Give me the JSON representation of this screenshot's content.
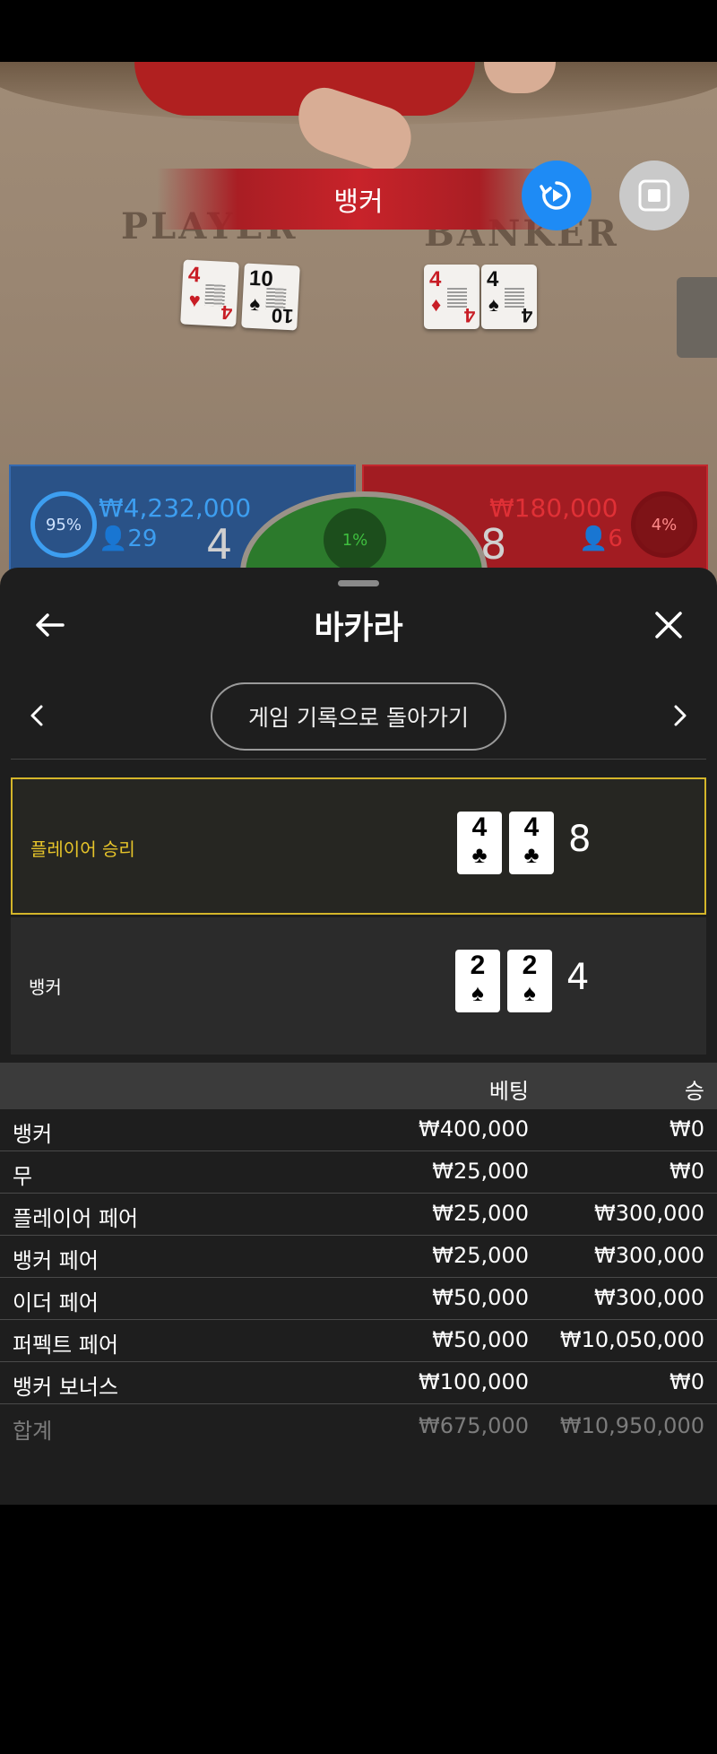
{
  "game": {
    "result_banner": "뱅커",
    "table_labels": {
      "player": "PLAYER",
      "banker": "BANKER"
    },
    "table_cards": {
      "player": [
        {
          "rank": "4",
          "suit": "♥",
          "color": "#c81d25"
        },
        {
          "rank": "10",
          "suit": "♠",
          "color": "#111111"
        }
      ],
      "banker": [
        {
          "rank": "4",
          "suit": "♦",
          "color": "#c81d25"
        },
        {
          "rank": "4",
          "suit": "♠",
          "color": "#111111"
        }
      ]
    }
  },
  "controls": {
    "replay_icon": "replay-icon",
    "stop_icon": "stop-icon"
  },
  "panels": {
    "player": {
      "percent": "95%",
      "amount": "₩4,232,000",
      "count": "29",
      "score": "4",
      "color": "#2a5287"
    },
    "tie": {
      "percent": "1%",
      "color": "#2c7a2c"
    },
    "banker": {
      "percent": "4%",
      "amount": "₩180,000",
      "count": "6",
      "score": "8",
      "color": "#a21c22"
    }
  },
  "sheet": {
    "title": "바카라",
    "history_button": "게임 기록으로 돌아가기",
    "results": [
      {
        "label": "플레이어 승리",
        "cards": [
          {
            "rank": "4",
            "suit": "♣"
          },
          {
            "rank": "4",
            "suit": "♣"
          }
        ],
        "score": "8",
        "highlight": "#d4b52a"
      },
      {
        "label": "뱅커",
        "cards": [
          {
            "rank": "2",
            "suit": "♠"
          },
          {
            "rank": "2",
            "suit": "♠"
          }
        ],
        "score": "4"
      }
    ],
    "bet_table": {
      "headers": {
        "bet": "베팅",
        "win": "승"
      },
      "rows": [
        {
          "name": "뱅커",
          "bet": "₩400,000",
          "win": "₩0"
        },
        {
          "name": "무",
          "bet": "₩25,000",
          "win": "₩0"
        },
        {
          "name": "플레이어 페어",
          "bet": "₩25,000",
          "win": "₩300,000"
        },
        {
          "name": "뱅커 페어",
          "bet": "₩25,000",
          "win": "₩300,000"
        },
        {
          "name": "이더 페어",
          "bet": "₩50,000",
          "win": "₩300,000"
        },
        {
          "name": "퍼펙트 페어",
          "bet": "₩50,000",
          "win": "₩10,050,000"
        },
        {
          "name": "뱅커 보너스",
          "bet": "₩100,000",
          "win": "₩0"
        }
      ],
      "total": {
        "name": "합계",
        "bet": "₩675,000",
        "win": "₩10,950,000"
      }
    }
  }
}
